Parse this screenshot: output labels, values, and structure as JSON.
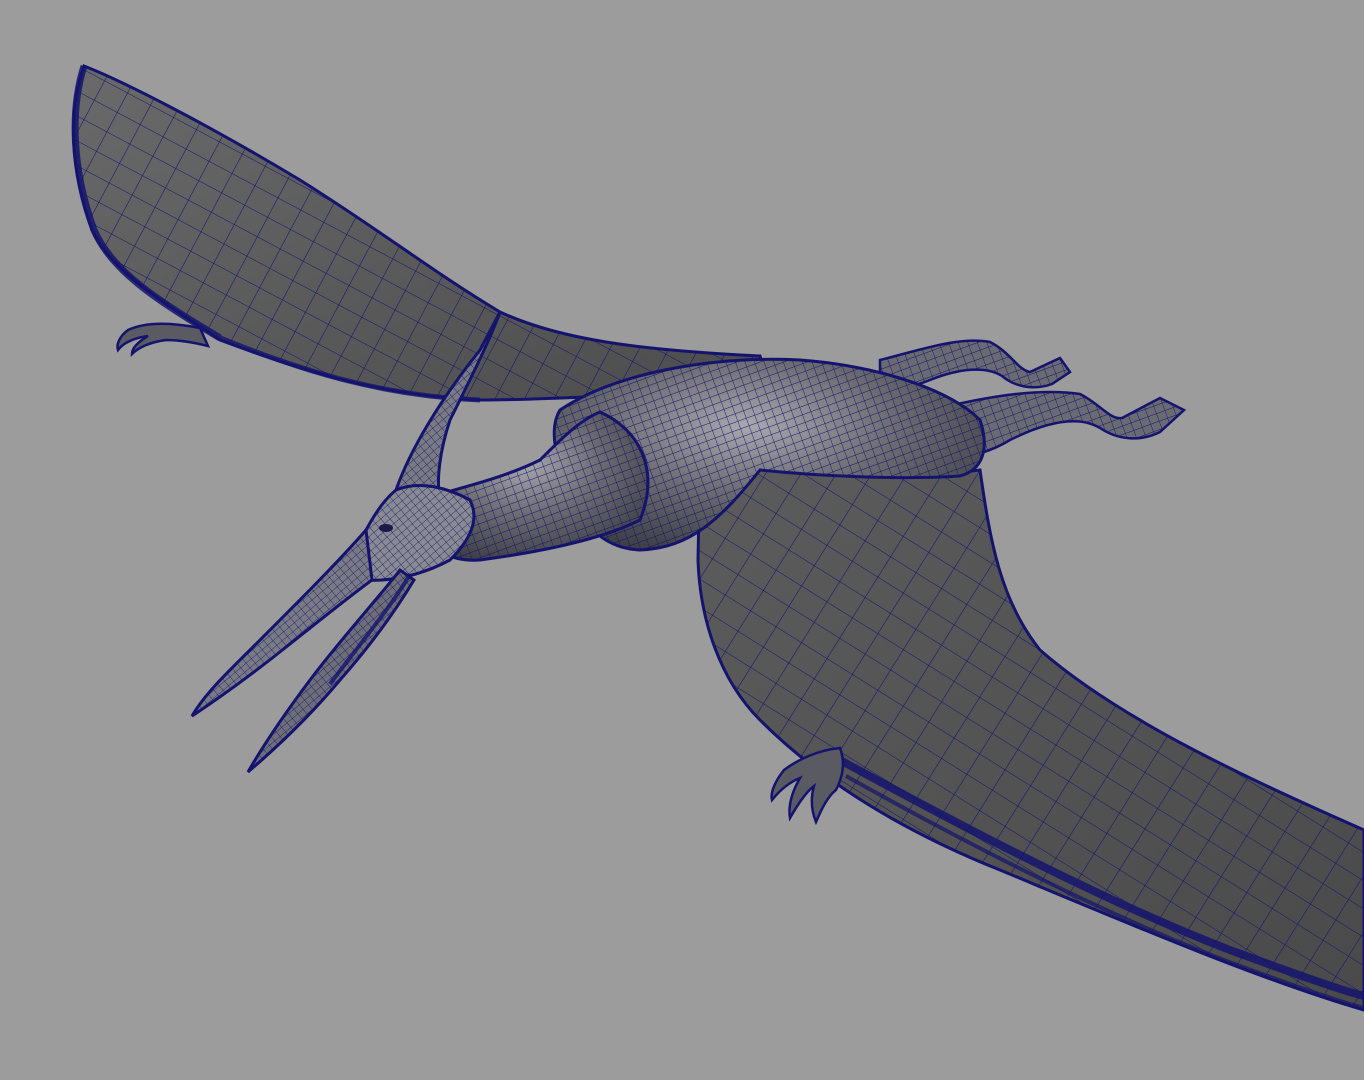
{
  "viewport": {
    "background_color": "#9c9c9c",
    "mesh_fill_color": "#585858",
    "mesh_fill_light": "#8a8a8a",
    "wire_color": "#14146e",
    "subject": "pterosaur-wireframe-model"
  }
}
